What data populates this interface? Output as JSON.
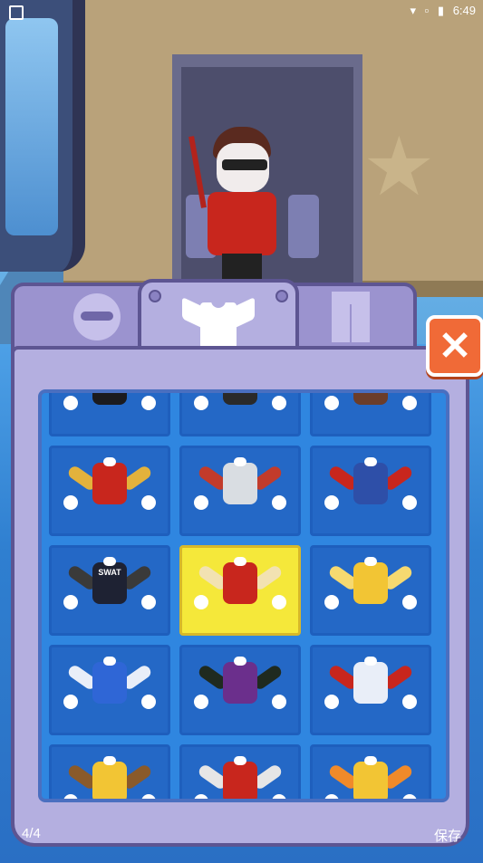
{
  "status_bar": {
    "time": "6:49",
    "icons": [
      "wifi-icon",
      "no-sim-icon",
      "battery-icon"
    ]
  },
  "tabs": [
    {
      "name": "glasses",
      "icon": "sunglasses-icon",
      "active": false
    },
    {
      "name": "tops",
      "icon": "tshirt-icon",
      "active": true
    },
    {
      "name": "pants",
      "icon": "pants-icon",
      "active": false
    }
  ],
  "close_icon": "close-icon",
  "outfits": [
    {
      "id": "outfit-1",
      "colors": [
        "#1b1b1f",
        "#ffffff"
      ],
      "selected": false
    },
    {
      "id": "outfit-2",
      "colors": [
        "#2a2a2a",
        "#d7a86b"
      ],
      "selected": false
    },
    {
      "id": "outfit-3",
      "colors": [
        "#6b3d2a",
        "#4b3a8a"
      ],
      "selected": false
    },
    {
      "id": "iron-suit",
      "colors": [
        "#c8261d",
        "#e3b23c"
      ],
      "selected": false
    },
    {
      "id": "space-suit",
      "colors": [
        "#d9dde2",
        "#c23b2b"
      ],
      "selected": false
    },
    {
      "id": "captain-suit",
      "colors": [
        "#2e4fa8",
        "#c8261d"
      ],
      "selected": false
    },
    {
      "id": "swat-vest",
      "colors": [
        "#1e2233",
        "#3a3a3a"
      ],
      "label": "SWAT",
      "selected": false
    },
    {
      "id": "red-jacket",
      "colors": [
        "#c8261d",
        "#f2e2b2"
      ],
      "selected": true
    },
    {
      "id": "yellow-hoodie",
      "colors": [
        "#f2c534",
        "#f6d970"
      ],
      "selected": false
    },
    {
      "id": "blue-hoodie",
      "colors": [
        "#2f66d6",
        "#e9eef8"
      ],
      "selected": false
    },
    {
      "id": "wrestler-top",
      "colors": [
        "#6b2f8c",
        "#1f2a1f"
      ],
      "selected": false
    },
    {
      "id": "sailor-top",
      "colors": [
        "#e9eef8",
        "#c8261d"
      ],
      "selected": false
    },
    {
      "id": "tattoo-vest",
      "colors": [
        "#f2c534",
        "#8a5a2a"
      ],
      "selected": false
    },
    {
      "id": "race-jacket",
      "colors": [
        "#c8261d",
        "#e6e6e6"
      ],
      "selected": false
    },
    {
      "id": "orange-tank",
      "colors": [
        "#f2c534",
        "#f08a2a"
      ],
      "selected": false
    }
  ],
  "footer": {
    "page_indicator": "4/4",
    "save_label": "保存"
  }
}
